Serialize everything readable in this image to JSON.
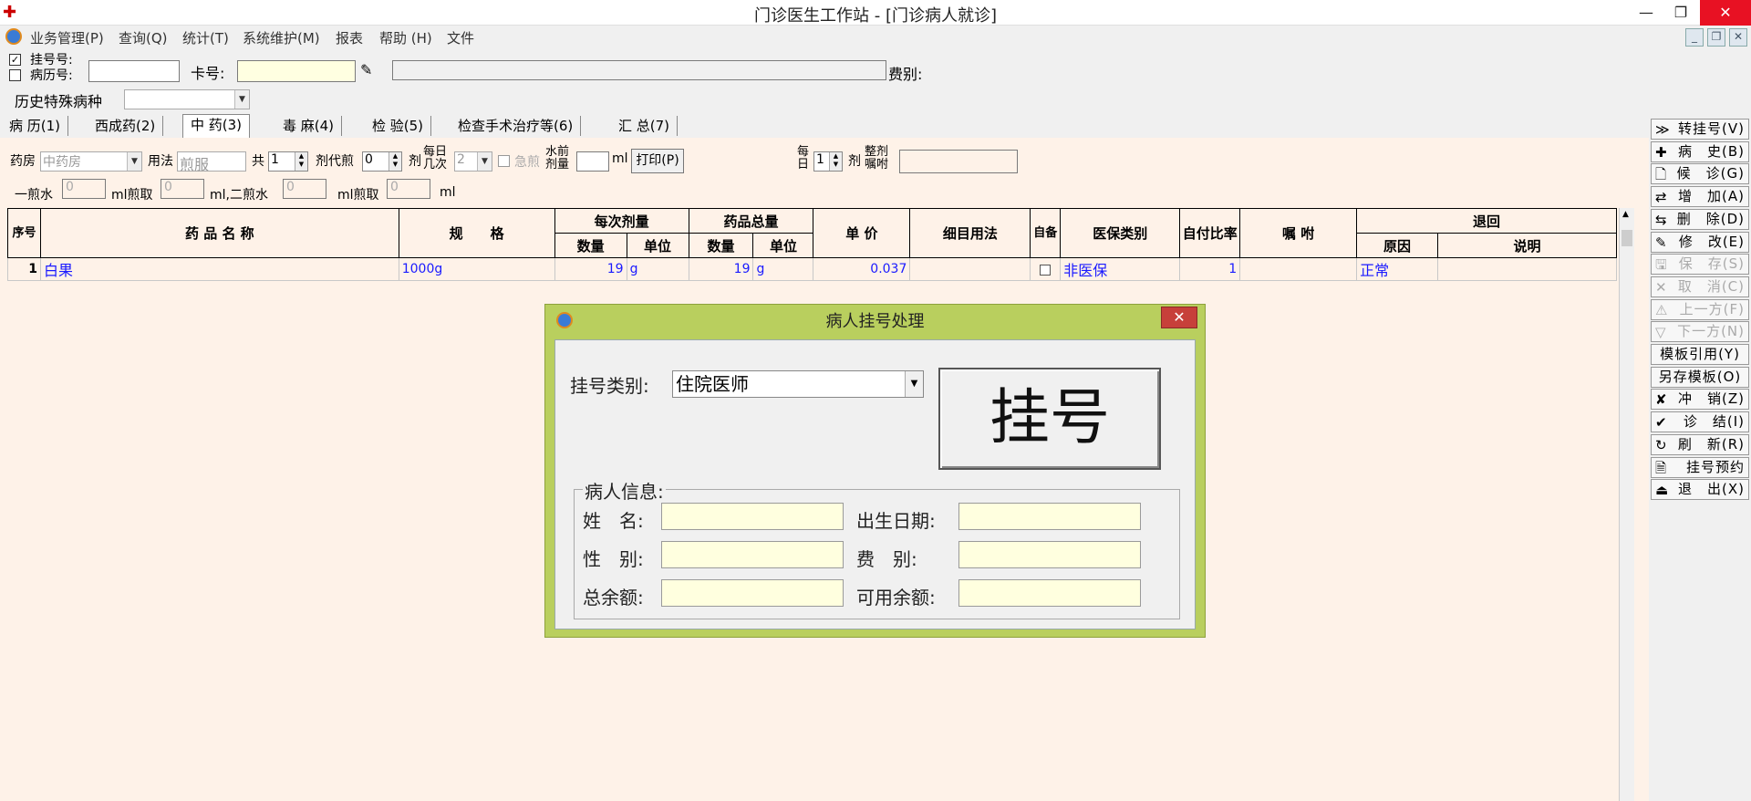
{
  "window": {
    "title": "门诊医生工作站 - [门诊病人就诊]",
    "min": "—",
    "max": "❐",
    "close": "✕"
  },
  "menu": [
    "业务管理(P)",
    "查询(Q)",
    "统计(T)",
    "系统维护(M)",
    "报表",
    "帮助 (H)",
    "文件"
  ],
  "mdi": {
    "min": "_",
    "restore": "❐",
    "close": "✕"
  },
  "search": {
    "reg_no_label": "挂号号:",
    "record_no_label": "病历号:",
    "card_label": "卡号:",
    "fee_label": "费别:",
    "history_label": "历史特殊病种"
  },
  "tabs": [
    "病 历(1)",
    "西成药(2)",
    "中 药(3)",
    "毒 麻(4)",
    "检 验(5)",
    "检查手术治疗等(6)",
    "汇 总(7)"
  ],
  "herb": {
    "pharmacy_label": "药房",
    "pharmacy_value": "中药房",
    "usage_label": "用法",
    "usage_value": "煎服",
    "total_label": "共",
    "total_value": "1",
    "dose_label": "剂代煎",
    "dose_value": "0",
    "dose_unit": "剂",
    "daily_label": "每日几次",
    "daily_value": "2",
    "urgent_label": "急煎",
    "water_label": "水前剂量",
    "water_unit": "ml",
    "print_label": "打印(P)",
    "per_day_label": "每日",
    "per_day_value": "1",
    "per_day_unit": "剂",
    "whole_label": "整剂嘱咐",
    "first_water_label": "一煎水",
    "first_water_value": "0",
    "first_take_label": "ml煎取",
    "first_take_value": "0",
    "second_water_label": "ml,二煎水",
    "second_water_value": "0",
    "second_take_label": "ml煎取",
    "second_take_value": "0",
    "ml": "ml"
  },
  "table": {
    "headers": {
      "seq": "序号",
      "name": "药 品 名 称",
      "spec": "规　　格",
      "each_dose": "每次剂量",
      "qty": "数量",
      "unit": "单位",
      "total": "药品总量",
      "price": "单 价",
      "usage": "细目用法",
      "self": "自备",
      "insurance": "医保类别",
      "ratio": "自付比率",
      "note": "嘱 咐",
      "return": "退回",
      "reason": "原因",
      "desc": "说明"
    },
    "rows": [
      {
        "seq": "1",
        "name": "白果",
        "spec": "1000g",
        "dose_qty": "19",
        "dose_unit": "g",
        "total_qty": "19",
        "total_unit": "g",
        "price": "0.037",
        "usage": "",
        "insurance": "非医保",
        "ratio": "1",
        "note": "",
        "reason": "正常",
        "desc": ""
      }
    ]
  },
  "toolbar": [
    {
      "icon": "≫",
      "label": "转挂号(V)",
      "disabled": false
    },
    {
      "icon": "✚",
      "label": "病　史(B)",
      "disabled": false
    },
    {
      "icon": "🗋",
      "label": "候　诊(G)",
      "disabled": false
    },
    {
      "icon": "⇄",
      "label": "增　加(A)",
      "disabled": false
    },
    {
      "icon": "⇆",
      "label": "删　除(D)",
      "disabled": false
    },
    {
      "icon": "✎",
      "label": "修　改(E)",
      "disabled": false
    },
    {
      "icon": "🖫",
      "label": "保　存(S)",
      "disabled": true
    },
    {
      "icon": "✕",
      "label": "取　消(C)",
      "disabled": true
    },
    {
      "icon": "⚠",
      "label": "上一方(F)",
      "disabled": true
    },
    {
      "icon": "▽",
      "label": "下一方(N)",
      "disabled": true
    },
    {
      "icon": "",
      "label": "模板引用(Y)",
      "disabled": false
    },
    {
      "icon": "",
      "label": "另存模板(O)",
      "disabled": false
    },
    {
      "icon": "✘",
      "label": "冲　销(Z)",
      "disabled": false
    },
    {
      "icon": "✔",
      "label": "诊　结(I)",
      "disabled": false
    },
    {
      "icon": "↻",
      "label": "刷　新(R)",
      "disabled": false
    },
    {
      "icon": "🗎",
      "label": "挂号预约",
      "disabled": false
    },
    {
      "icon": "⏏",
      "label": "退　出(X)",
      "disabled": false
    }
  ],
  "dialog": {
    "title": "病人挂号处理",
    "close": "✕",
    "reg_type_label": "挂号类别:",
    "reg_type_value": "住院医师",
    "register_button": "挂号",
    "group_label": "病人信息:",
    "name_label": "姓　名:",
    "birth_label": "出生日期:",
    "gender_label": "性　别:",
    "fee_label": "费　别:",
    "balance_label": "总余额:",
    "available_label": "可用余额:"
  },
  "colors": {
    "accent_dialog": "#b9cf5e",
    "grid_bg": "#fef2e8",
    "data_text": "#1a1aff",
    "close_red": "#e81123"
  }
}
